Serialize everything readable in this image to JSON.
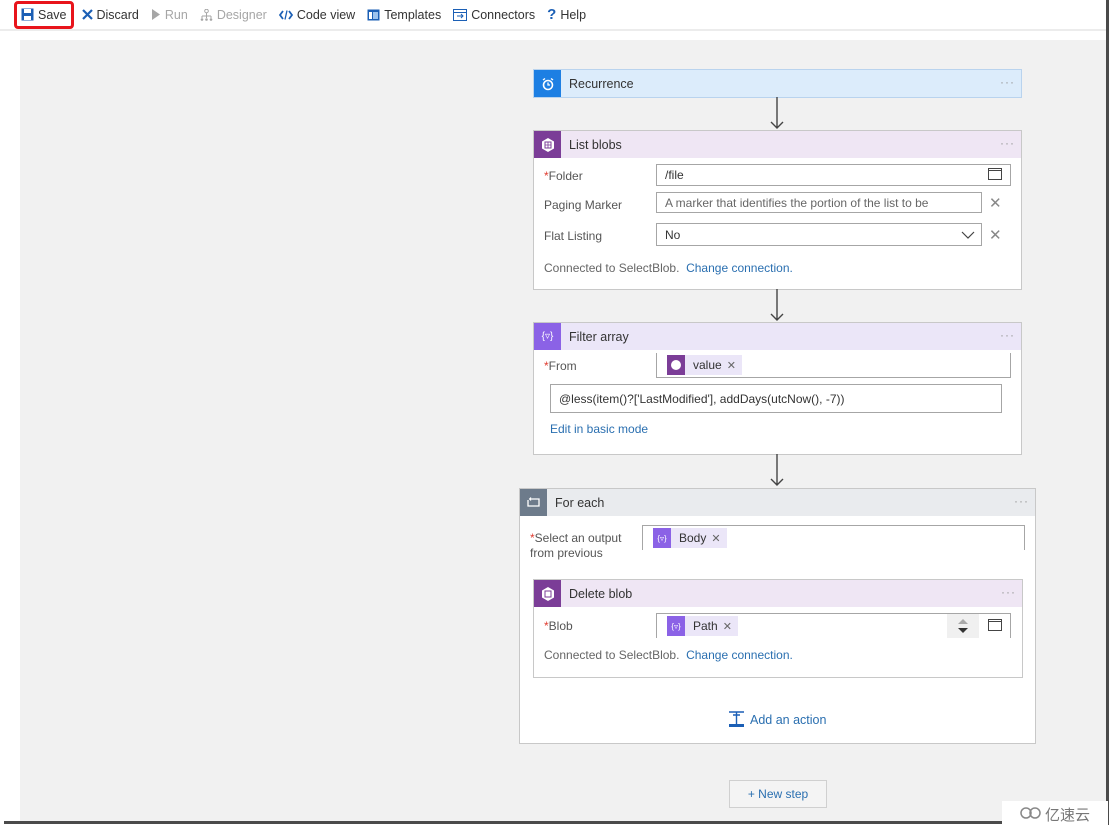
{
  "toolbar": {
    "items": [
      {
        "label": "Save",
        "icon": "save-icon",
        "enabled": true,
        "highlighted": true
      },
      {
        "label": "Discard",
        "icon": "close-icon",
        "enabled": true
      },
      {
        "label": "Run",
        "icon": "play-icon",
        "enabled": false
      },
      {
        "label": "Designer",
        "icon": "designer-icon",
        "enabled": false
      },
      {
        "label": "Code view",
        "icon": "code-icon",
        "enabled": true
      },
      {
        "label": "Templates",
        "icon": "templates-icon",
        "enabled": true
      },
      {
        "label": "Connectors",
        "icon": "connectors-icon",
        "enabled": true
      },
      {
        "label": "Help",
        "icon": "help-icon",
        "enabled": true
      }
    ],
    "highlight_color": "#e8141b"
  },
  "steps": {
    "recurrence": {
      "title": "Recurrence",
      "icon": "alarm-clock-icon",
      "more": "···"
    },
    "list_blobs": {
      "title": "List blobs",
      "icon": "storage-icon",
      "more": "···",
      "fields": {
        "folder": {
          "required": "*",
          "label": "Folder",
          "value": "/file"
        },
        "paging_marker": {
          "label": "Paging Marker",
          "placeholder": "A marker that identifies the portion of the list to be"
        },
        "flat_listing": {
          "label": "Flat Listing",
          "value": "No"
        }
      },
      "connected_text": "Connected to SelectBlob.",
      "change_connection": "Change connection."
    },
    "filter_array": {
      "title": "Filter array",
      "icon": "filter-expression-icon",
      "more": "···",
      "from": {
        "required": "*",
        "label": "From",
        "token": "value"
      },
      "expression": "@less(item()?['LastModified'], addDays(utcNow(), -7))",
      "edit_mode_link": "Edit in basic mode"
    },
    "for_each": {
      "title": "For each",
      "icon": "loop-icon",
      "more": "···",
      "select_output": {
        "required": "*",
        "label_line1": "Select an output",
        "label_line2": "from previous",
        "token": "Body"
      },
      "delete_blob": {
        "title": "Delete blob",
        "icon": "storage-icon",
        "more": "···",
        "blob": {
          "required": "*",
          "label": "Blob",
          "token": "Path"
        },
        "connected_text": "Connected to SelectBlob.",
        "change_connection": "Change connection."
      },
      "add_action": "Add an action"
    }
  },
  "new_step": "+ New step",
  "watermark": "亿速云"
}
